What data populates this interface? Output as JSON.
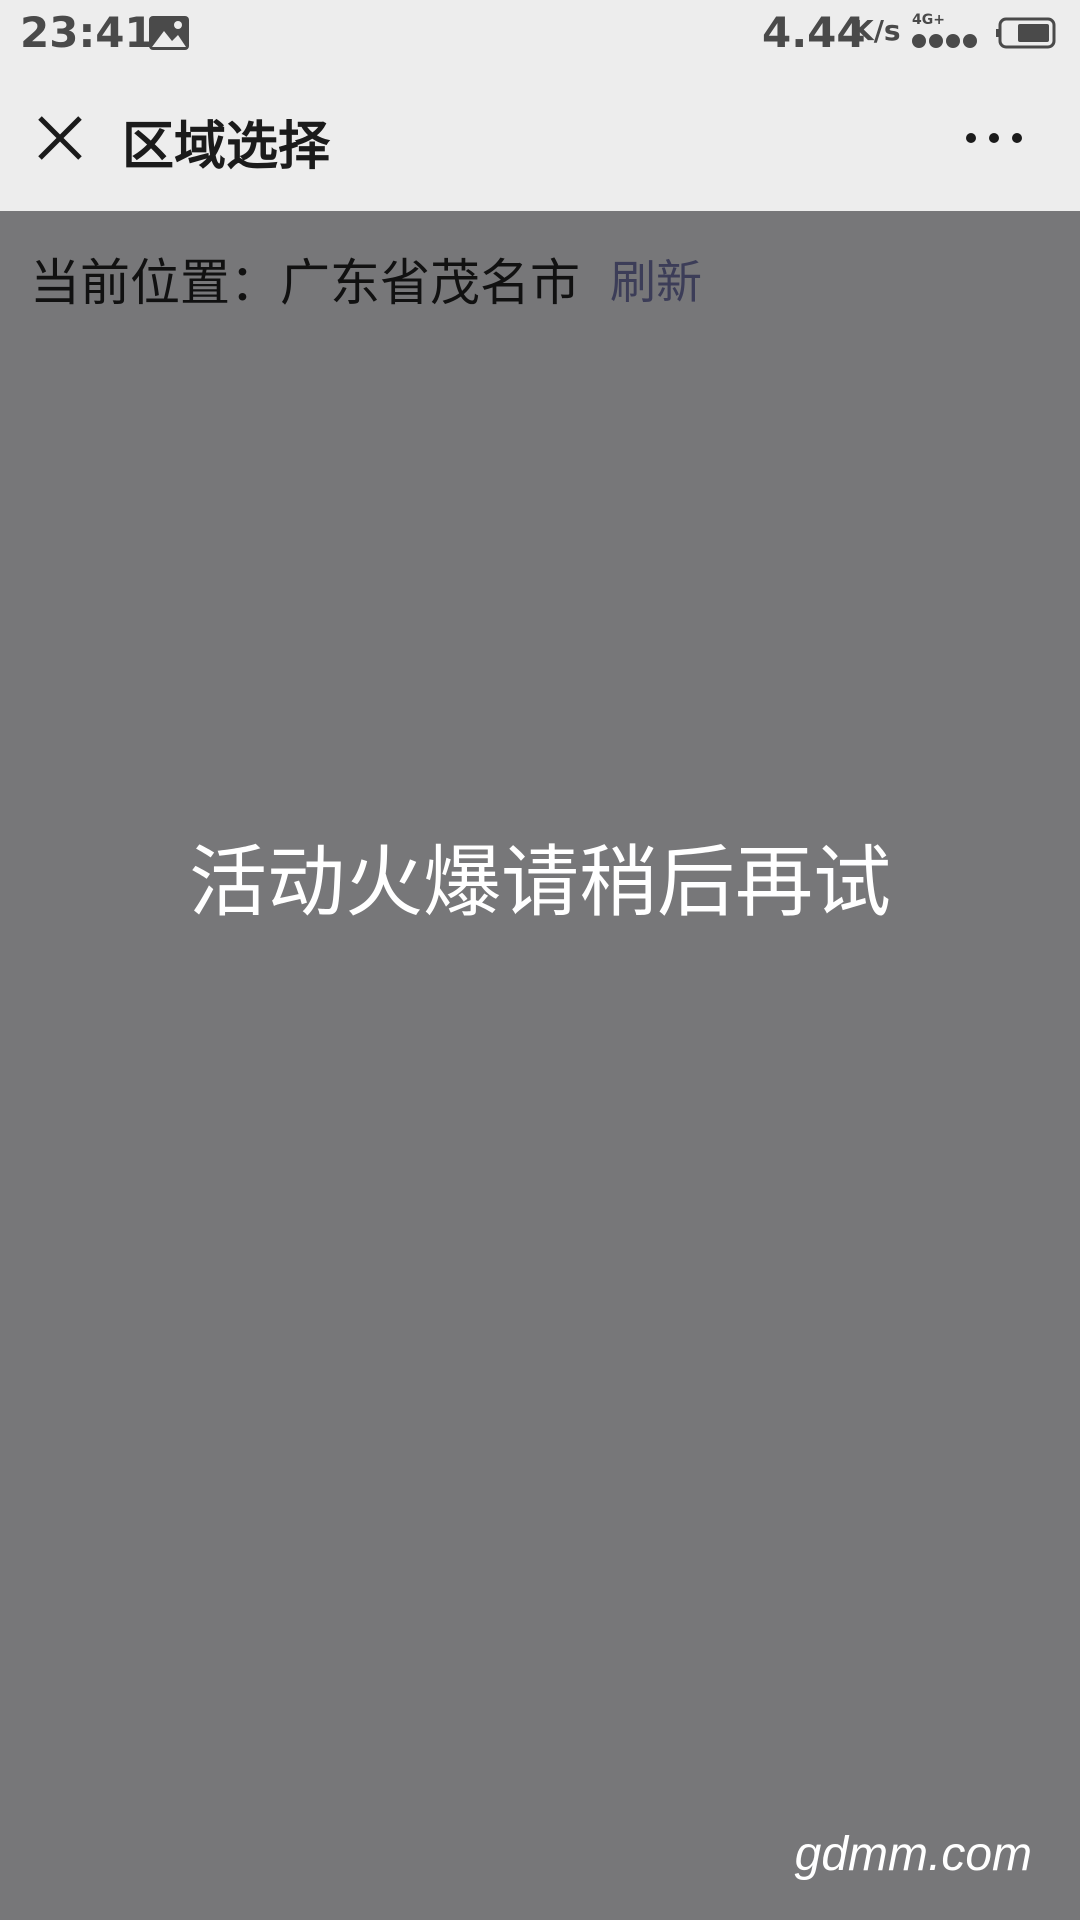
{
  "status_bar": {
    "time": "23:41",
    "speed": "4.44",
    "speed_unit": "K/s",
    "network": "4G+",
    "icons": [
      "gallery-icon",
      "signal-icon",
      "battery-icon"
    ]
  },
  "title_bar": {
    "title": "区域选择",
    "close_icon": "close-icon",
    "more_icon": "more-icon"
  },
  "location": {
    "label": "当前位置：",
    "value": "广东省茂名市",
    "refresh": "刷新"
  },
  "message": "活动火爆请稍后再试",
  "watermark": "gdmm.com",
  "colors": {
    "bar_background": "#ededed",
    "overlay": "#777779",
    "refresh_link": "#3c3d58",
    "message_text": "#ffffff"
  }
}
